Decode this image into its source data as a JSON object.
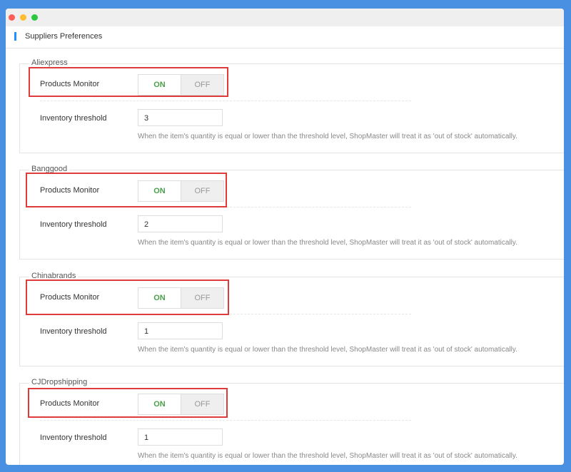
{
  "header": {
    "title": "Suppliers Preferences"
  },
  "sections": [
    {
      "name": "Aliexpress",
      "monitor_label": "Products Monitor",
      "on_label": "ON",
      "off_label": "OFF",
      "monitor_state": "on",
      "threshold_label": "Inventory threshold",
      "threshold_value": "3",
      "help": "When the item's quantity is equal or lower than the threshold level, ShopMaster will treat it as 'out of stock' automatically."
    },
    {
      "name": "Banggood",
      "monitor_label": "Products Monitor",
      "on_label": "ON",
      "off_label": "OFF",
      "monitor_state": "on",
      "threshold_label": "Inventory threshold",
      "threshold_value": "2",
      "help": "When the item's quantity is equal or lower than the threshold level, ShopMaster will treat it as 'out of stock' automatically."
    },
    {
      "name": "Chinabrands",
      "monitor_label": "Products Monitor",
      "on_label": "ON",
      "off_label": "OFF",
      "monitor_state": "on",
      "threshold_label": "Inventory threshold",
      "threshold_value": "1",
      "help": "When the item's quantity is equal or lower than the threshold level, ShopMaster will treat it as 'out of stock' automatically."
    },
    {
      "name": "CJDropshipping",
      "monitor_label": "Products Monitor",
      "on_label": "ON",
      "off_label": "OFF",
      "monitor_state": "on",
      "threshold_label": "Inventory threshold",
      "threshold_value": "1",
      "help": "When the item's quantity is equal or lower than the threshold level, ShopMaster will treat it as 'out of stock' automatically."
    }
  ],
  "colors": {
    "background": "#4a90e2",
    "on_text": "#4aa14a",
    "highlight": "#e03b3b",
    "accent": "#1e90ff"
  }
}
